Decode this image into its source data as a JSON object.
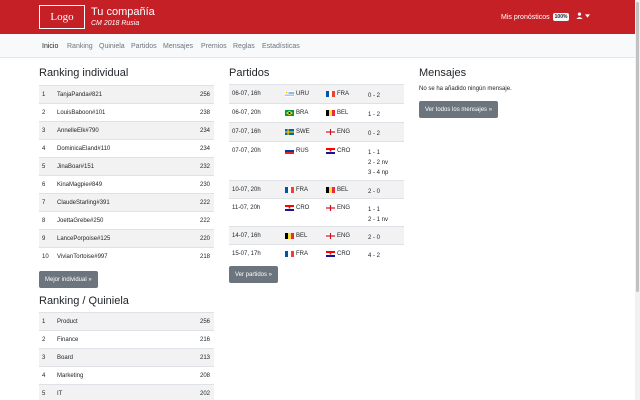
{
  "header": {
    "logo": "Logo",
    "company": "Tu compañía",
    "subtitle": "CM 2018 Rusia",
    "predictions_label": "Mis pronósticos",
    "predictions_badge": "100%"
  },
  "nav": [
    "Inicio",
    "Ranking",
    "Quiniela",
    "Partidos",
    "Mensajes",
    "Premios",
    "Reglas",
    "Estadísticas"
  ],
  "ranking_individual": {
    "title": "Ranking individual",
    "rows": [
      {
        "pos": "1",
        "name": "TanjaPanda#821",
        "pts": "256"
      },
      {
        "pos": "2",
        "name": "LouisBaboon#101",
        "pts": "238"
      },
      {
        "pos": "3",
        "name": "AnnelleElk#790",
        "pts": "234"
      },
      {
        "pos": "4",
        "name": "DominicaEland#110",
        "pts": "234"
      },
      {
        "pos": "5",
        "name": "JinaBoar#151",
        "pts": "232"
      },
      {
        "pos": "6",
        "name": "KinaMagpie#849",
        "pts": "230"
      },
      {
        "pos": "7",
        "name": "ClaudeStarling#391",
        "pts": "222"
      },
      {
        "pos": "8",
        "name": "JoettaGrebe#250",
        "pts": "222"
      },
      {
        "pos": "9",
        "name": "LancePorpoise#125",
        "pts": "220"
      },
      {
        "pos": "10",
        "name": "VivianTortoise#997",
        "pts": "218"
      }
    ],
    "button": "Mejor individual »"
  },
  "ranking_quiniela": {
    "title": "Ranking / Quiniela",
    "rows": [
      {
        "pos": "1",
        "name": "Product",
        "pts": "256"
      },
      {
        "pos": "2",
        "name": "Finance",
        "pts": "216"
      },
      {
        "pos": "3",
        "name": "Board",
        "pts": "213"
      },
      {
        "pos": "4",
        "name": "Marketing",
        "pts": "208"
      },
      {
        "pos": "5",
        "name": "IT",
        "pts": "202"
      }
    ]
  },
  "partidos": {
    "title": "Partidos",
    "matches": [
      {
        "date": "06-07, 16h",
        "team1": "URU",
        "team2": "FRA",
        "results": [
          "0 - 2"
        ]
      },
      {
        "date": "06-07, 20h",
        "team1": "BRA",
        "team2": "BEL",
        "results": [
          "1 - 2"
        ]
      },
      {
        "date": "07-07, 16h",
        "team1": "SWE",
        "team2": "ENG",
        "results": [
          "0 - 2"
        ]
      },
      {
        "date": "07-07, 20h",
        "team1": "RUS",
        "team2": "CRO",
        "results": [
          "1 - 1",
          "2 - 2 nv",
          "3 - 4 np"
        ]
      },
      {
        "date": "10-07, 20h",
        "team1": "FRA",
        "team2": "BEL",
        "results": [
          "2 - 0"
        ]
      },
      {
        "date": "11-07, 20h",
        "team1": "CRO",
        "team2": "ENG",
        "results": [
          "1 - 1",
          "2 - 1 nv"
        ]
      },
      {
        "date": "14-07, 16h",
        "team1": "BEL",
        "team2": "ENG",
        "results": [
          "2 - 0"
        ]
      },
      {
        "date": "15-07, 17h",
        "team1": "FRA",
        "team2": "CRO",
        "results": [
          "4 - 2"
        ]
      }
    ],
    "button": "Ver partidos »"
  },
  "mensajes": {
    "title": "Mensajes",
    "empty_text": "No se ha añadido ningún mensaje.",
    "button": "Ver todos los mensajes »"
  },
  "colors": {
    "brand_red": "#c62027",
    "button_gray": "#6c757d"
  }
}
